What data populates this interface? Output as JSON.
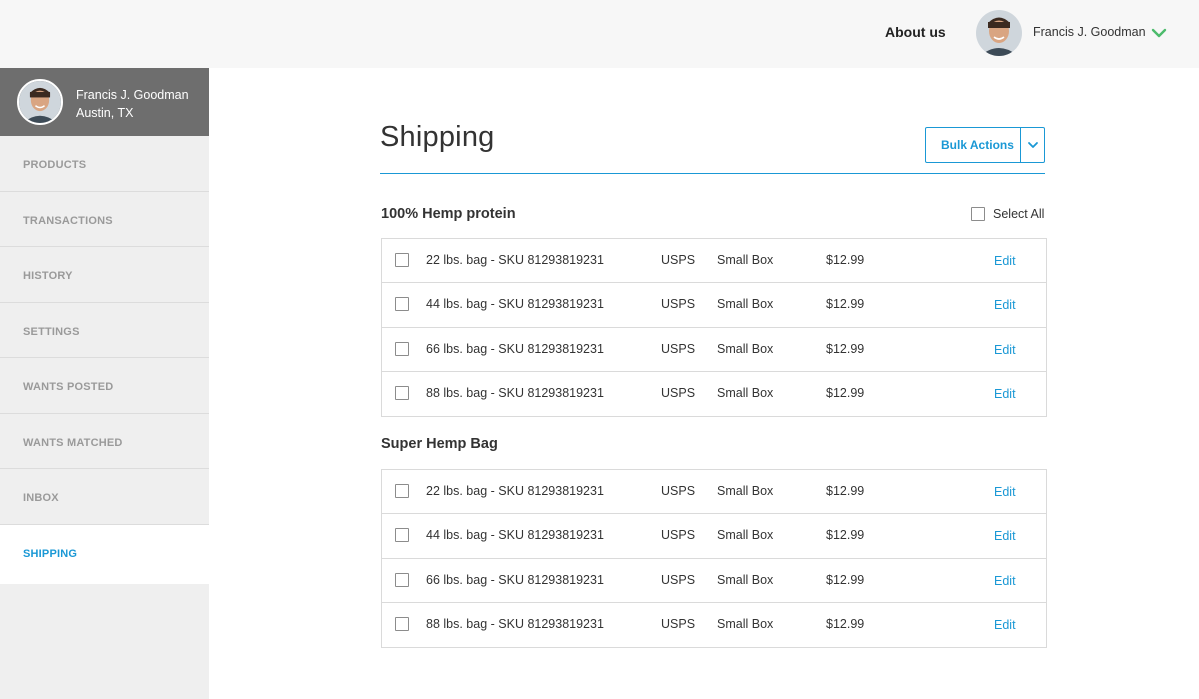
{
  "header": {
    "about_label": "About us",
    "user_name": "Francis J. Goodman"
  },
  "sidebar": {
    "profile": {
      "name": "Francis J. Goodman",
      "location": "Austin, TX"
    },
    "items": [
      {
        "label": "PRODUCTS"
      },
      {
        "label": "TRANSACTIONS"
      },
      {
        "label": "HISTORY"
      },
      {
        "label": "SETTINGS"
      },
      {
        "label": "WANTS POSTED"
      },
      {
        "label": "WANTS MATCHED"
      },
      {
        "label": "INBOX"
      },
      {
        "label": "SHIPPING"
      }
    ]
  },
  "main": {
    "title": "Shipping",
    "bulk_label": "Bulk Actions",
    "select_all_label": "Select All",
    "groups": [
      {
        "name": "100% Hemp protein",
        "rows": [
          {
            "desc": "22 lbs. bag - SKU 81293819231",
            "carrier": "USPS",
            "box": "Small Box",
            "price": "$12.99",
            "action": "Edit"
          },
          {
            "desc": "44 lbs. bag - SKU 81293819231",
            "carrier": "USPS",
            "box": "Small Box",
            "price": "$12.99",
            "action": "Edit"
          },
          {
            "desc": "66 lbs. bag - SKU 81293819231",
            "carrier": "USPS",
            "box": "Small Box",
            "price": "$12.99",
            "action": "Edit"
          },
          {
            "desc": "88 lbs. bag - SKU 81293819231",
            "carrier": "USPS",
            "box": "Small Box",
            "price": "$12.99",
            "action": "Edit"
          }
        ]
      },
      {
        "name": "Super Hemp Bag",
        "rows": [
          {
            "desc": "22 lbs. bag - SKU 81293819231",
            "carrier": "USPS",
            "box": "Small Box",
            "price": "$12.99",
            "action": "Edit"
          },
          {
            "desc": "44 lbs. bag - SKU 81293819231",
            "carrier": "USPS",
            "box": "Small Box",
            "price": "$12.99",
            "action": "Edit"
          },
          {
            "desc": "66 lbs. bag - SKU 81293819231",
            "carrier": "USPS",
            "box": "Small Box",
            "price": "$12.99",
            "action": "Edit"
          },
          {
            "desc": "88 lbs. bag - SKU 81293819231",
            "carrier": "USPS",
            "box": "Small Box",
            "price": "$12.99",
            "action": "Edit"
          }
        ]
      }
    ]
  },
  "colors": {
    "accent": "#1a98d5",
    "chevron": "#4cbb6c",
    "sidebar_profile_bg": "#6e6e6e",
    "sidebar_bg": "#efefef"
  },
  "icons": {
    "user_menu": "chevron-down-icon",
    "bulk_menu": "chevron-down-icon"
  }
}
